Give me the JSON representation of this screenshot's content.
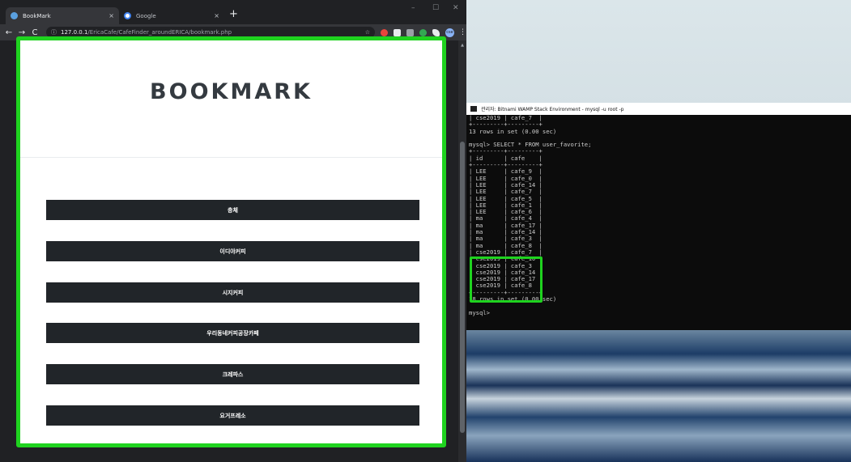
{
  "browser": {
    "tabs": [
      {
        "title": "BookMark",
        "close": "×"
      },
      {
        "title": "Google",
        "close": "×"
      }
    ],
    "new_tab": "+",
    "window_controls": {
      "minimize": "–",
      "maximize": "☐",
      "close": "✕"
    },
    "nav": {
      "back": "←",
      "forward": "→",
      "reload": "C",
      "info": "ⓘ"
    },
    "url": {
      "host": "127.0.0.1",
      "path": "/EricaCafe/CafeFinder_aroundERICA/bookmark.php"
    },
    "star": "☆",
    "profile": "cse",
    "menu": "⋮"
  },
  "page": {
    "title": "BOOKMARK",
    "cafes": [
      "층체",
      "이디야커피",
      "시지커피",
      "우리동네커피공장카페",
      "크레파스",
      "요거프레소"
    ]
  },
  "terminal": {
    "title": "관리자: Bitnami WAMP Stack Environment - mysql  -u root -p",
    "lines": [
      "| cse2019 | cafe_7  |",
      "+---------+---------+",
      "13 rows in set (0.00 sec)",
      "",
      "mysql> SELECT * FROM user_favorite;",
      "+---------+---------+",
      "| id      | cafe    |",
      "+---------+---------+",
      "| LEE     | cafe_9  |",
      "| LEE     | cafe_0  |",
      "| LEE     | cafe_14 |",
      "| LEE     | cafe_7  |",
      "| LEE     | cafe_5  |",
      "| LEE     | cafe_1  |",
      "| LEE     | cafe_6  |",
      "| ma      | cafe_4  |",
      "| ma      | cafe_17 |",
      "| ma      | cafe_14 |",
      "| ma      | cafe_3  |",
      "| ma      | cafe_8  |",
      "| cse2019 | cafe_7  |",
      "| cse2019 | cafe_10 |",
      "| cse2019 | cafe_3  |",
      "| cse2019 | cafe_14 |",
      "| cse2019 | cafe_17 |",
      "| cse2019 | cafe_8  |",
      "+---------+---------+",
      "18 rows in set (0.00 sec)",
      "",
      "mysql>"
    ]
  },
  "colors": {
    "highlight": "#1fd31f",
    "button": "#212529",
    "terminal_bg": "#0c0c0c"
  }
}
